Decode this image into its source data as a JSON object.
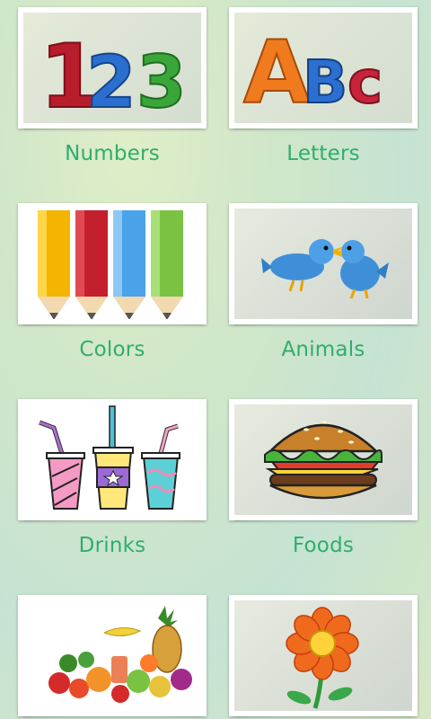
{
  "categories": [
    {
      "label": "Numbers",
      "icon": "numbers-123-icon"
    },
    {
      "label": "Letters",
      "icon": "letters-abc-icon"
    },
    {
      "label": "Colors",
      "icon": "colored-pencils-icon"
    },
    {
      "label": "Animals",
      "icon": "blue-birds-icon"
    },
    {
      "label": "Drinks",
      "icon": "drink-cups-icon"
    },
    {
      "label": "Foods",
      "icon": "burger-icon"
    },
    {
      "label": "",
      "icon": "fruits-vegetables-icon"
    },
    {
      "label": "",
      "icon": "flower-icon"
    }
  ],
  "art_text": {
    "numbers": [
      "1",
      "2",
      "3"
    ],
    "letters": [
      "A",
      "B",
      "c"
    ]
  },
  "colors": {
    "label_green": "#2fae6c",
    "digit1": "#b81d2b",
    "digit2": "#2a6fcf",
    "digit3": "#3aa63a",
    "letterA": "#f07a1e",
    "letterB": "#2b6fd0",
    "letterC": "#c8233a"
  }
}
